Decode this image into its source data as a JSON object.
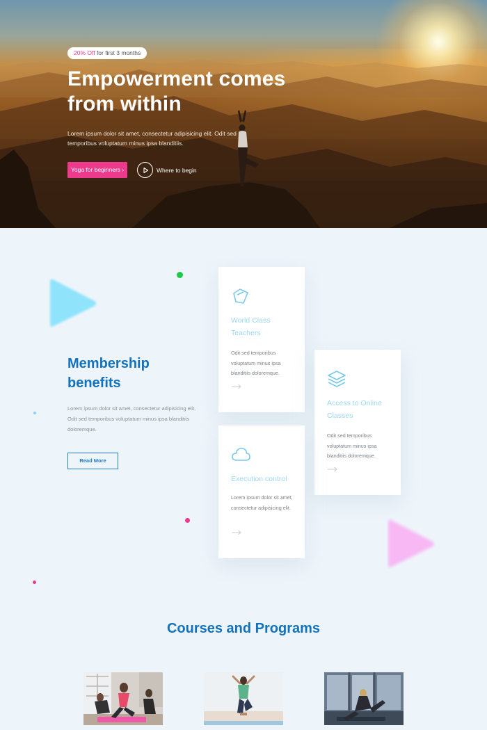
{
  "hero": {
    "badge_accent": "20% Off",
    "badge_rest": "for first 3 months",
    "title": "Empowerment comes from within",
    "lead": "Lorem ipsum dolor sit amet, consectetur adipisicing elit. Odit sed temporibus voluptatum minus ipsa blanditiis.",
    "primary_button": "Yoga for beginners ›",
    "secondary_link": "Where to begin",
    "icons": {
      "play": "play-icon"
    }
  },
  "benefits": {
    "title": "Membership benefits",
    "text": "Lorem ipsum dolor sit amet, consectetur adipisicing elit. Odit sed temporibus voluptatum minus ipsa blanditiis doloremque.",
    "button": "Read More",
    "cards": [
      {
        "icon": "diamond-icon",
        "title": "World Class Teachers",
        "text": "Odit sed temporibus voluptatum minus ipsa blanditiis doloremque."
      },
      {
        "icon": "layers-icon",
        "title": "Access to Online Classes",
        "text": "Odit sed temporibus voluptatum minus ipsa blanditiis doloremque."
      },
      {
        "icon": "cloud-icon",
        "title": "Execution control",
        "text": "Lorem ipsum dolor sit amet, consectetur adipisicing elit."
      }
    ]
  },
  "courses": {
    "title": "Courses and Programs"
  },
  "colors": {
    "accent_pink": "#ee3a8c",
    "heading_blue": "#1372be",
    "card_title": "#9ed8ef",
    "background": "#eef5fa"
  }
}
